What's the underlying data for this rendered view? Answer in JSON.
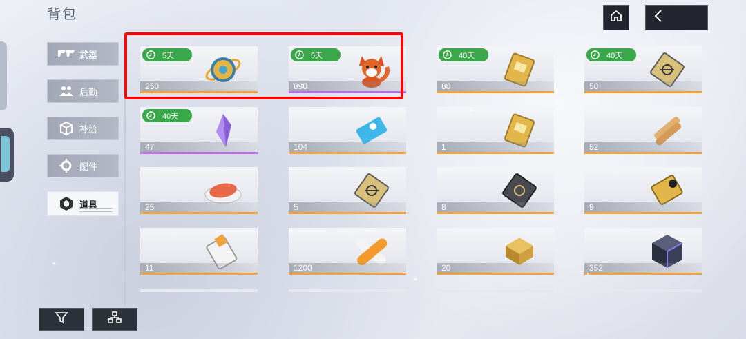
{
  "page": {
    "title": "背包"
  },
  "sidebar": {
    "items": [
      {
        "label": "武器",
        "icon": "weapon-icon"
      },
      {
        "label": "后勤",
        "icon": "people-icon"
      },
      {
        "label": "补给",
        "icon": "cube-icon"
      },
      {
        "label": "配件",
        "icon": "gear-icon"
      },
      {
        "label": "道具",
        "icon": "item-icon",
        "active": true
      }
    ]
  },
  "top_buttons": {
    "home_icon": "home-icon",
    "back_icon": "back-arrow-icon"
  },
  "bottom_buttons": {
    "filter_icon": "filter-icon",
    "sort_icon": "sort-icon"
  },
  "items": [
    {
      "count": "250",
      "badge": "5天",
      "art": "golden-orb",
      "rarity": "orange"
    },
    {
      "count": "890",
      "badge": "5天",
      "art": "fox-plush",
      "rarity": "purple"
    },
    {
      "count": "80",
      "badge": "40天",
      "art": "gold-chip",
      "rarity": "orange"
    },
    {
      "count": "50",
      "badge": "40天",
      "art": "data-card",
      "rarity": "orange"
    },
    {
      "count": "47",
      "badge": "40天",
      "art": "purple-crystal",
      "rarity": "purple"
    },
    {
      "count": "104",
      "badge": "",
      "art": "blue-ticket",
      "rarity": "orange"
    },
    {
      "count": "1",
      "badge": "",
      "art": "gold-chip",
      "rarity": "orange"
    },
    {
      "count": "52",
      "badge": "",
      "art": "wood-planks",
      "rarity": "orange"
    },
    {
      "count": "25",
      "badge": "",
      "art": "fish-plate",
      "rarity": "orange"
    },
    {
      "count": "5",
      "badge": "",
      "art": "data-card",
      "rarity": "orange"
    },
    {
      "count": "8",
      "badge": "",
      "art": "dark-card",
      "rarity": "orange"
    },
    {
      "count": "9",
      "badge": "",
      "art": "gold-card",
      "rarity": "orange"
    },
    {
      "count": "11",
      "badge": "",
      "art": "white-card",
      "rarity": "orange"
    },
    {
      "count": "1200",
      "badge": "",
      "art": "orange-capsule",
      "rarity": "orange"
    },
    {
      "count": "20",
      "badge": "",
      "art": "gold-module",
      "rarity": "orange"
    },
    {
      "count": "352",
      "badge": "",
      "art": "dark-cube",
      "rarity": "orange"
    }
  ],
  "colors": {
    "badge_green": "#3aa84a",
    "rarity_orange": "#f0a33c",
    "rarity_purple": "#b76ee0",
    "highlight_red": "#f00a0a"
  }
}
